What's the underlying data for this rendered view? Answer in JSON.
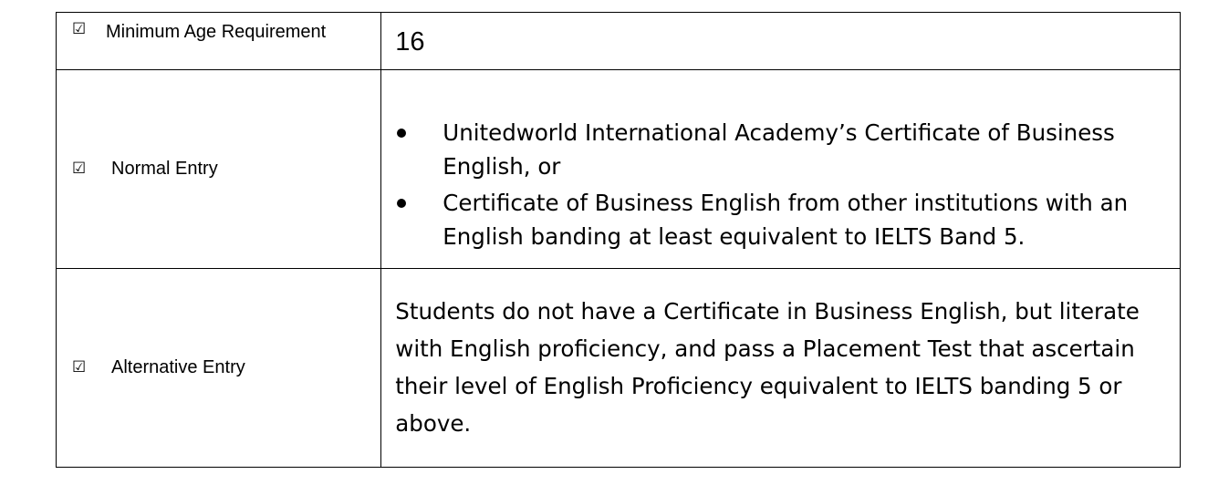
{
  "checkbox_glyph": "☑",
  "rows": [
    {
      "label": "Minimum Age Requirement",
      "value": "16"
    },
    {
      "label": "Normal Entry",
      "bullets": [
        "Unitedworld International Academy’s Certificate of Business English, or",
        "Certificate of Business English from other institutions with an English banding at least equivalent to IELTS Band 5."
      ]
    },
    {
      "label": "Alternative Entry",
      "value": "Students do not have a Certificate in Business English, but literate with English proficiency, and pass a Placement Test that ascertain their level of English Proficiency equivalent to IELTS banding 5 or above."
    }
  ]
}
